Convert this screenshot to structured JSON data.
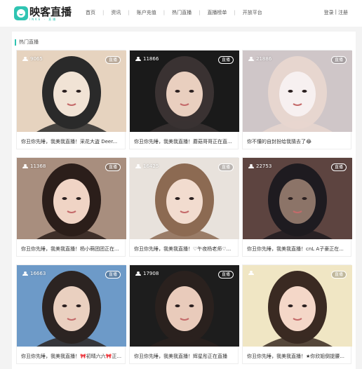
{
  "header": {
    "logo_title": "映客直播",
    "logo_sub": "INKE · 直播",
    "nav": [
      {
        "label": "首页"
      },
      {
        "label": "资讯"
      },
      {
        "label": "账户充值"
      },
      {
        "label": "热门直播"
      },
      {
        "label": "直播榜单"
      },
      {
        "label": "开放平台"
      }
    ],
    "login": "登录",
    "auth_sep": "|",
    "register": "注册"
  },
  "section": {
    "title": "热门直播"
  },
  "cards": [
    {
      "viewers": "9065",
      "badge": "直播",
      "caption": "你丑你先睡，我美我直播！采花大盗 Deer...",
      "colors": [
        "#e6d3bf",
        "#2a2a2a",
        "#f1e3d5"
      ]
    },
    {
      "viewers": "11866",
      "badge": "直播",
      "caption": "你丑你先睡，我美我直播！蘑菇哥哥正在直...",
      "colors": [
        "#1a1a1a",
        "#3a3232",
        "#e9cfbf"
      ]
    },
    {
      "viewers": "21886",
      "badge": "直播",
      "caption": "你不懂的自封扮给我猜去了😂",
      "colors": [
        "#cfc6c8",
        "#e7d6cf",
        "#f7f0f0"
      ]
    },
    {
      "viewers": "11368",
      "badge": "直播",
      "caption": "你丑你先睡，我美我直播！杨小萌团团正在...",
      "colors": [
        "#a88e7e",
        "#2b1e1a",
        "#f0d4c5"
      ]
    },
    {
      "viewers": "16425",
      "badge": "直播",
      "caption": "你丑你先睡，我美我直播！♡午夜杨老师♡...",
      "colors": [
        "#e8e2dc",
        "#8c6a52",
        "#f2dccf"
      ]
    },
    {
      "viewers": "22753",
      "badge": "直播",
      "caption": "你丑你先睡，我美我直播！cnL A子豪正在...",
      "colors": [
        "#5d4440",
        "#1e1b20",
        "#8c7468"
      ]
    },
    {
      "viewers": "16663",
      "badge": "直播",
      "caption": "你丑你先睡，我美我直播！🎀初晴六六🎀正...",
      "colors": [
        "#6d9ac8",
        "#2c2422",
        "#ead0c0"
      ]
    },
    {
      "viewers": "17908",
      "badge": "直播",
      "caption": "你丑你先睡，我美我直播！辉星彤正在直播",
      "colors": [
        "#1d1d1d",
        "#2a211e",
        "#e9cbbb"
      ]
    },
    {
      "viewers": "",
      "badge": "直播",
      "caption": "你丑你先睡，我美我直播！★你欣姐倒提腰...",
      "colors": [
        "#f0e6c4",
        "#3a2a22",
        "#f4d7c8"
      ]
    }
  ]
}
